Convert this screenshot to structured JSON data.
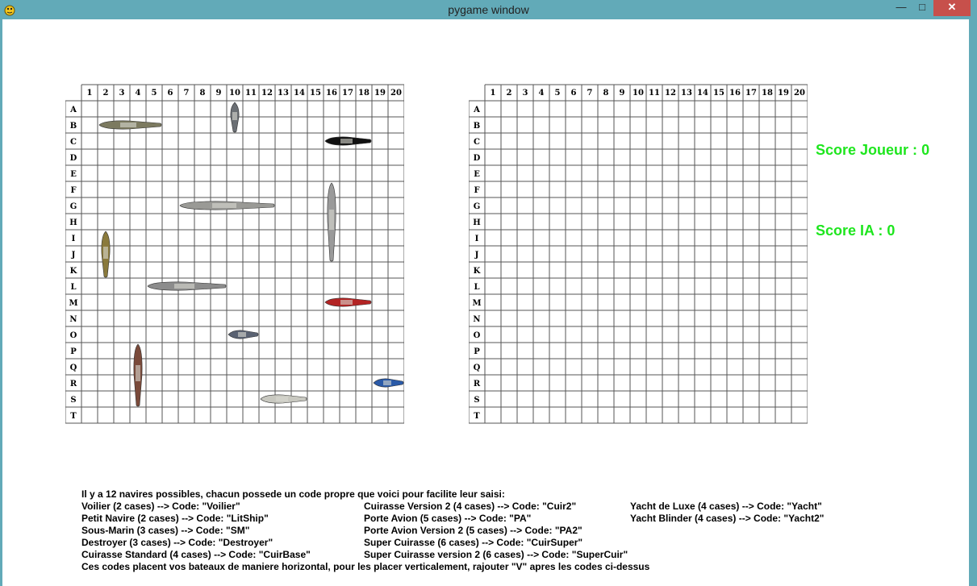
{
  "window": {
    "title": "pygame window",
    "minimize_glyph": "—",
    "maximize_glyph": "□",
    "close_glyph": "✕"
  },
  "boards": {
    "columns": [
      "1",
      "2",
      "3",
      "4",
      "5",
      "6",
      "7",
      "8",
      "9",
      "10",
      "11",
      "12",
      "13",
      "14",
      "15",
      "16",
      "17",
      "18",
      "19",
      "20"
    ],
    "rows": [
      "A",
      "B",
      "C",
      "D",
      "E",
      "F",
      "G",
      "H",
      "I",
      "J",
      "K",
      "L",
      "M",
      "N",
      "O",
      "P",
      "Q",
      "R",
      "S",
      "T"
    ]
  },
  "ships": [
    {
      "name": "battleship-icon-b",
      "row": "B",
      "col": 2,
      "len": 4,
      "dir": "H",
      "color": "#7c7a60"
    },
    {
      "name": "small-boat-icon-a",
      "row": "A",
      "col": 10,
      "len": 2,
      "dir": "V",
      "color": "#6b6f74"
    },
    {
      "name": "submarine-icon-c",
      "row": "C",
      "col": 16,
      "len": 3,
      "dir": "H",
      "color": "#111111"
    },
    {
      "name": "cruiser-icon-g",
      "row": "G",
      "col": 7,
      "len": 6,
      "dir": "H",
      "color": "#9a9a96"
    },
    {
      "name": "carrier-icon-f",
      "row": "F",
      "col": 16,
      "len": 5,
      "dir": "V",
      "color": "#9a9a9a"
    },
    {
      "name": "sailboat-icon-i",
      "row": "I",
      "col": 2,
      "len": 3,
      "dir": "V",
      "color": "#8a7a3c"
    },
    {
      "name": "carrier-icon-l",
      "row": "L",
      "col": 5,
      "len": 5,
      "dir": "H",
      "color": "#8c8c8c"
    },
    {
      "name": "yacht-icon-m",
      "row": "M",
      "col": 16,
      "len": 3,
      "dir": "H",
      "color": "#b32424"
    },
    {
      "name": "destroyer-icon-o",
      "row": "O",
      "col": 10,
      "len": 2,
      "dir": "H",
      "color": "#5a6272"
    },
    {
      "name": "super-cruiser-icon-p",
      "row": "P",
      "col": 4,
      "len": 4,
      "dir": "V",
      "color": "#7a4a3a"
    },
    {
      "name": "yacht-icon-r",
      "row": "R",
      "col": 19,
      "len": 2,
      "dir": "H",
      "color": "#2a5aa8"
    },
    {
      "name": "luxury-yacht-icon-s",
      "row": "S",
      "col": 12,
      "len": 3,
      "dir": "H",
      "color": "#c8c8c0"
    }
  ],
  "scores": {
    "player_label": "Score Joueur :",
    "player_value": "0",
    "ai_label": "Score IA :",
    "ai_value": "0"
  },
  "info": {
    "header": "Il y a 12 navires possibles, chacun possede un code propre que voici pour facilite leur saisi:",
    "col1": [
      "Voilier (2 cases) --> Code: \"Voilier\"",
      "Petit Navire (2 cases) --> Code: \"LitShip\"",
      "Sous-Marin (3 cases) --> Code: \"SM\"",
      "Destroyer (3 cases) --> Code: \"Destroyer\"",
      "Cuirasse Standard (4 cases) --> Code: \"CuirBase\""
    ],
    "col2": [
      "Cuirasse Version 2 (4 cases) --> Code: \"Cuir2\"",
      "Porte Avion (5 cases) --> Code: \"PA\"",
      "Porte Avion Version 2 (5 cases) --> Code: \"PA2\"",
      "Super Cuirasse (6 cases) --> Code: \"CuirSuper\"",
      "Super Cuirasse version 2 (6 cases) --> Code: \"SuperCuir\""
    ],
    "col3": [
      "Yacht de Luxe (4 cases) --> Code: \"Yacht\"",
      "Yacht Blinder (4 cases) --> Code: \"Yacht2\""
    ],
    "footer": "Ces codes placent vos bateaux de maniere horizontal, pour les placer verticalement, rajouter \"V\" apres les codes ci-dessus"
  }
}
